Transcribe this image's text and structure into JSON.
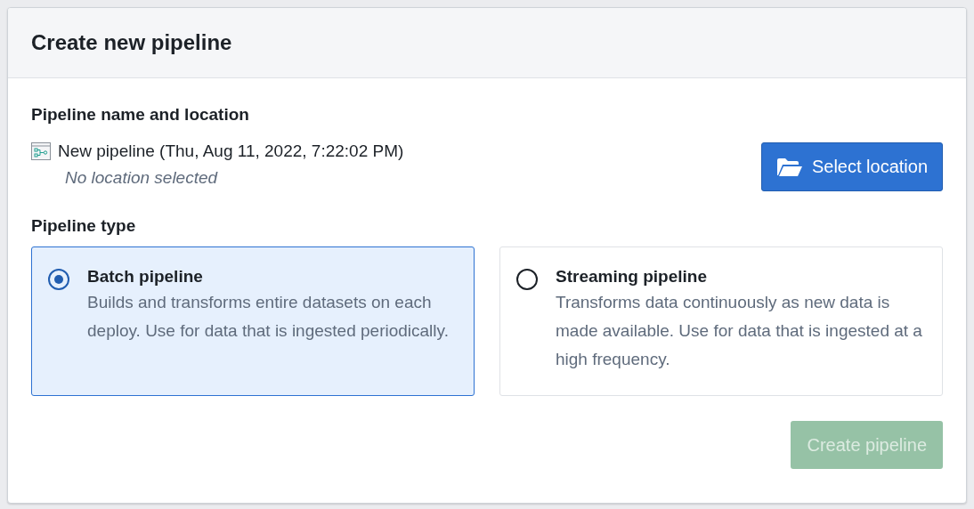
{
  "dialog": {
    "title": "Create new pipeline"
  },
  "name_section": {
    "label": "Pipeline name and location",
    "pipeline_name": "New pipeline (Thu, Aug 11, 2022, 7:22:02 PM)",
    "location": "No location selected",
    "button": "Select location"
  },
  "type_section": {
    "label": "Pipeline type",
    "options": [
      {
        "title": "Batch pipeline",
        "description": "Builds and transforms entire datasets on each deploy. Use for data that is ingested periodically.",
        "selected": true
      },
      {
        "title": "Streaming pipeline",
        "description": "Transforms data continuously as new data is made available. Use for data that is ingested at a high frequency.",
        "selected": false
      }
    ]
  },
  "footer": {
    "button": "Create pipeline",
    "disabled": true
  }
}
